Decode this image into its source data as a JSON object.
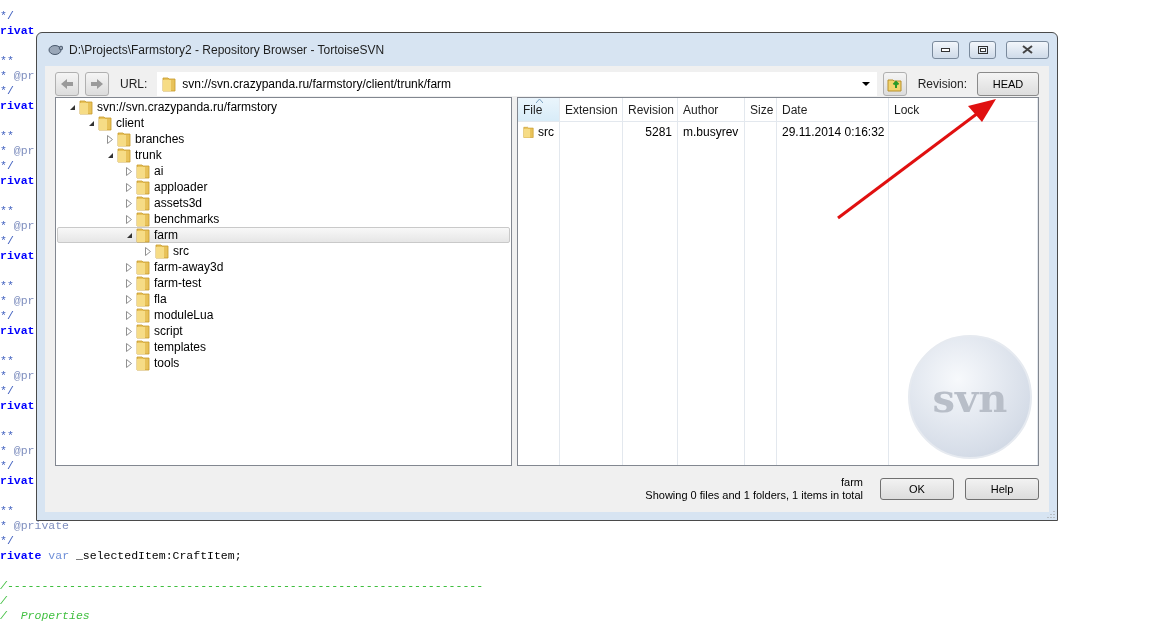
{
  "editor": {
    "blocks": [
      {
        "lines": [
          [
            {
              "text": "*/",
              "kind": "doc"
            }
          ],
          [
            {
              "text": "rivat",
              "kind": "keyword"
            }
          ]
        ]
      },
      {
        "lines": [
          [
            {
              "text": "**",
              "kind": "doc"
            }
          ],
          [
            {
              "text": "* ",
              "kind": "doc"
            },
            {
              "text": "@pr",
              "kind": "tag"
            }
          ],
          [
            {
              "text": "*/",
              "kind": "doc"
            }
          ],
          [
            {
              "text": "rivat",
              "kind": "keyword"
            }
          ]
        ]
      },
      {
        "lines": [
          [
            {
              "text": "**",
              "kind": "doc"
            }
          ],
          [
            {
              "text": "* ",
              "kind": "doc"
            },
            {
              "text": "@pr",
              "kind": "tag"
            }
          ],
          [
            {
              "text": "*/",
              "kind": "doc"
            }
          ],
          [
            {
              "text": "rivat",
              "kind": "keyword"
            }
          ]
        ]
      },
      {
        "lines": [
          [
            {
              "text": "**",
              "kind": "doc"
            }
          ],
          [
            {
              "text": "* ",
              "kind": "doc"
            },
            {
              "text": "@pr",
              "kind": "tag"
            }
          ],
          [
            {
              "text": "*/",
              "kind": "doc"
            }
          ],
          [
            {
              "text": "rivat",
              "kind": "keyword"
            }
          ]
        ]
      },
      {
        "lines": [
          [
            {
              "text": "**",
              "kind": "doc"
            }
          ],
          [
            {
              "text": "* ",
              "kind": "doc"
            },
            {
              "text": "@pr",
              "kind": "tag"
            }
          ],
          [
            {
              "text": "*/",
              "kind": "doc"
            }
          ],
          [
            {
              "text": "rivat",
              "kind": "keyword"
            }
          ]
        ]
      },
      {
        "lines": [
          [
            {
              "text": "**",
              "kind": "doc"
            }
          ],
          [
            {
              "text": "* ",
              "kind": "doc"
            },
            {
              "text": "@pr",
              "kind": "tag"
            }
          ],
          [
            {
              "text": "*/",
              "kind": "doc"
            }
          ],
          [
            {
              "text": "rivat",
              "kind": "keyword"
            }
          ]
        ]
      },
      {
        "lines": [
          [
            {
              "text": "**",
              "kind": "doc"
            }
          ],
          [
            {
              "text": "* ",
              "kind": "doc"
            },
            {
              "text": "@pr",
              "kind": "tag"
            }
          ],
          [
            {
              "text": "*/",
              "kind": "doc"
            }
          ],
          [
            {
              "text": "rivat",
              "kind": "keyword"
            }
          ]
        ]
      },
      {
        "lines": [
          [
            {
              "text": "**",
              "kind": "doc"
            }
          ],
          [
            {
              "text": "* ",
              "kind": "doc"
            },
            {
              "text": "@private",
              "kind": "tag"
            }
          ],
          [
            {
              "text": "*/",
              "kind": "doc"
            }
          ],
          [
            {
              "text": "rivate",
              "kind": "keyword"
            },
            {
              "text": " var",
              "kind": "type"
            },
            {
              "text": " _selectedItem:CraftItem;",
              "kind": "plain"
            }
          ]
        ]
      },
      {
        "lines": [
          [
            {
              "text": "/---------------------------------------------------------------------",
              "kind": "comment"
            }
          ],
          [
            {
              "text": "/",
              "kind": "comment"
            }
          ],
          [
            {
              "text": "/  Properties",
              "kind": "comment"
            }
          ]
        ]
      }
    ]
  },
  "window": {
    "title": "D:\\Projects\\Farmstory2 - Repository Browser - TortoiseSVN"
  },
  "toolbar": {
    "url_label": "URL:",
    "url": "svn://svn.crazypanda.ru/farmstory/client/trunk/farm",
    "revision_label": "Revision:",
    "revision": "HEAD"
  },
  "tree": [
    {
      "label": "svn://svn.crazypanda.ru/farmstory",
      "expanded": true,
      "selected": false,
      "children": [
        {
          "label": "client",
          "expanded": true,
          "selected": false,
          "children": [
            {
              "label": "branches",
              "expanded": false,
              "selected": false
            },
            {
              "label": "trunk",
              "expanded": true,
              "selected": false,
              "children": [
                {
                  "label": "ai",
                  "expanded": false,
                  "selected": false
                },
                {
                  "label": "apploader",
                  "expanded": false,
                  "selected": false
                },
                {
                  "label": "assets3d",
                  "expanded": false,
                  "selected": false
                },
                {
                  "label": "benchmarks",
                  "expanded": false,
                  "selected": false
                },
                {
                  "label": "farm",
                  "expanded": true,
                  "selected": true,
                  "children": [
                    {
                      "label": "src",
                      "expanded": false,
                      "selected": false
                    }
                  ]
                },
                {
                  "label": "farm-away3d",
                  "expanded": false,
                  "selected": false
                },
                {
                  "label": "farm-test",
                  "expanded": false,
                  "selected": false
                },
                {
                  "label": "fla",
                  "expanded": false,
                  "selected": false
                },
                {
                  "label": "moduleLua",
                  "expanded": false,
                  "selected": false
                },
                {
                  "label": "script",
                  "expanded": false,
                  "selected": false
                },
                {
                  "label": "templates",
                  "expanded": false,
                  "selected": false
                },
                {
                  "label": "tools",
                  "expanded": false,
                  "selected": false
                }
              ]
            }
          ]
        }
      ]
    }
  ],
  "list": {
    "columns": [
      {
        "label": "File",
        "sorted": true
      },
      {
        "label": "Extension",
        "sorted": false
      },
      {
        "label": "Revision",
        "sorted": false
      },
      {
        "label": "Author",
        "sorted": false
      },
      {
        "label": "Size",
        "sorted": false
      },
      {
        "label": "Date",
        "sorted": false
      },
      {
        "label": "Lock",
        "sorted": false
      }
    ],
    "rows": [
      {
        "file": "src",
        "revision": "5281",
        "author": "m.busyrev",
        "date": "29.11.2014 0:16:32"
      }
    ],
    "logo_text": "svn"
  },
  "status_bar": {
    "path": "farm",
    "summary": "Showing 0 files and 1 folders, 1 items in total"
  },
  "buttons": [
    "OK",
    "Help"
  ]
}
